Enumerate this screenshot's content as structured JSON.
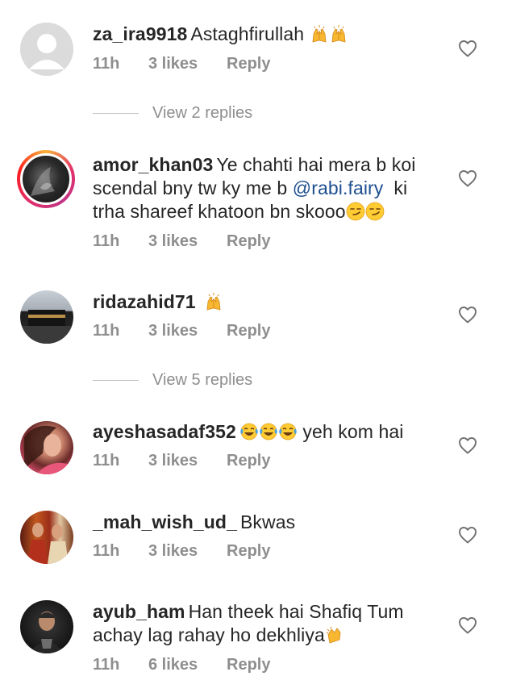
{
  "comments": [
    {
      "username": "za_ira9918",
      "text": "Astaghfirullah",
      "emoji": "raising-hands,raising-hands",
      "time": "11h",
      "likes": "3 likes",
      "reply": "Reply"
    },
    {
      "username": "amor_khan03",
      "text_before": "Ye chahti hai mera b koi scendal bny tw ky me b",
      "mention": "@rabi.fairy",
      "text_after": "ki trha shareef khatoon bn skooo",
      "emoji": "smirk,smirk",
      "time": "11h",
      "likes": "3 likes",
      "reply": "Reply"
    },
    {
      "username": "ridazahid71",
      "text": "",
      "emoji": "raising-hands",
      "time": "11h",
      "likes": "3 likes",
      "reply": "Reply"
    },
    {
      "username": "ayeshasadaf352",
      "text": "yeh kom hai",
      "emoji": "tears-of-joy,tears-of-joy,tears-of-joy",
      "time": "11h",
      "likes": "3 likes",
      "reply": "Reply"
    },
    {
      "username": "_mah_wish_ud_",
      "text": "Bkwas",
      "time": "11h",
      "likes": "3 likes",
      "reply": "Reply"
    },
    {
      "username": "ayub_ham",
      "text": "Han theek hai Shafiq Tum achay lag rahay ho dekhliya",
      "emoji": "clapping-hands",
      "time": "11h",
      "likes": "6 likes",
      "reply": "Reply"
    }
  ],
  "view_replies": [
    {
      "label": "View 2 replies"
    },
    {
      "label": "View 5 replies"
    }
  ],
  "colors": {
    "text": "#262626",
    "meta": "#8e8e8e",
    "mention": "#1e4f8f",
    "heart_stroke": "#8e8e8e"
  },
  "icons": {
    "like": "heart-outline-icon",
    "avatar_default": "default-avatar-icon"
  }
}
